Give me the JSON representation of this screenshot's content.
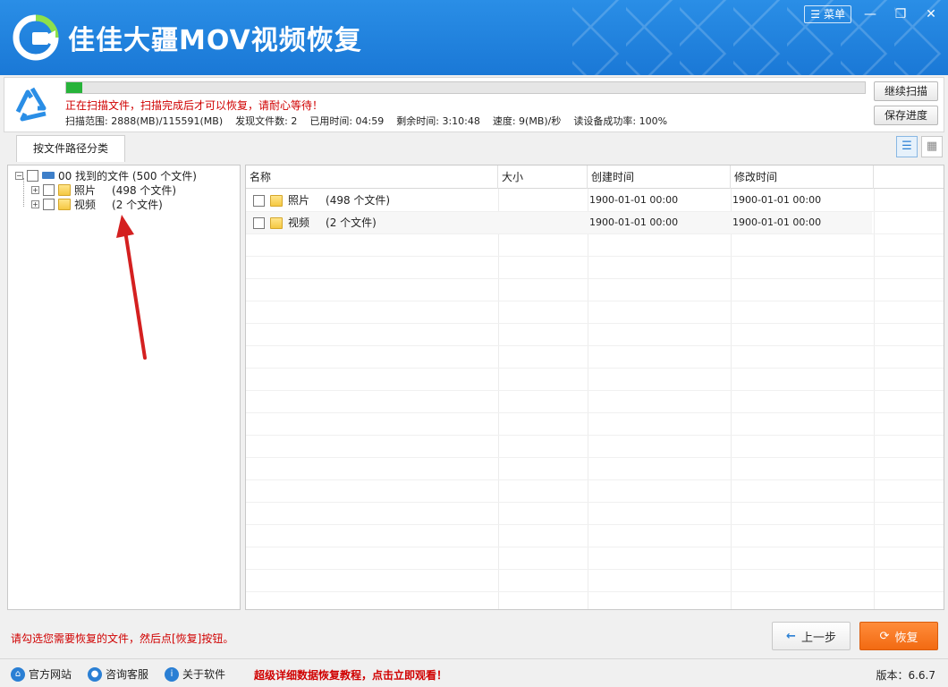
{
  "app": {
    "title": "佳佳大疆MOV视频恢复",
    "menu_label": "菜单",
    "minimize_icon": "minimize-icon",
    "maximize_icon": "maximize-icon",
    "close_icon": "close-icon"
  },
  "scan": {
    "progress_fraction": 0.02,
    "message": "正在扫描文件，扫描完成后才可以恢复，请耐心等待！",
    "stats": [
      "扫描范围: 2888(MB)/115591(MB)",
      "发现文件数: 2",
      "已用时间: 04:59",
      "剩余时间: 3:10:48",
      "速度: 9(MB)/秒",
      "读设备成功率: 100%"
    ],
    "continue_label": "继续扫描",
    "save_label": "保存进度"
  },
  "tabs": {
    "active": "按文件路径分类"
  },
  "tree": {
    "root": {
      "label": "00 找到的文件 (500 个文件)"
    },
    "children": [
      {
        "label": "照片",
        "count": "(498 个文件)"
      },
      {
        "label": "视频",
        "count": "(2 个文件)"
      }
    ]
  },
  "list": {
    "columns": [
      "名称",
      "大小",
      "创建时间",
      "修改时间"
    ],
    "rows": [
      {
        "name": "照片",
        "count": "(498 个文件)",
        "size": "",
        "created": "1900-01-01  00:00",
        "modified": "1900-01-01  00:00"
      },
      {
        "name": "视频",
        "count": "(2 个文件)",
        "size": "",
        "created": "1900-01-01  00:00",
        "modified": "1900-01-01  00:00"
      }
    ]
  },
  "bottom": {
    "hint": "请勾选您需要恢复的文件，然后点[恢复]按钮。",
    "prev_label": "上一步",
    "recover_label": "恢复"
  },
  "footer": {
    "links": [
      "官方网站",
      "咨询客服",
      "关于软件"
    ],
    "promo": "超级详细数据恢复教程，点击立即观看！",
    "version": "版本：6.6.7"
  },
  "colors": {
    "title_bar": "#1a78d6",
    "progress": "#27b33a",
    "alert_text": "#d00000",
    "recover_button": "#f26a12"
  }
}
